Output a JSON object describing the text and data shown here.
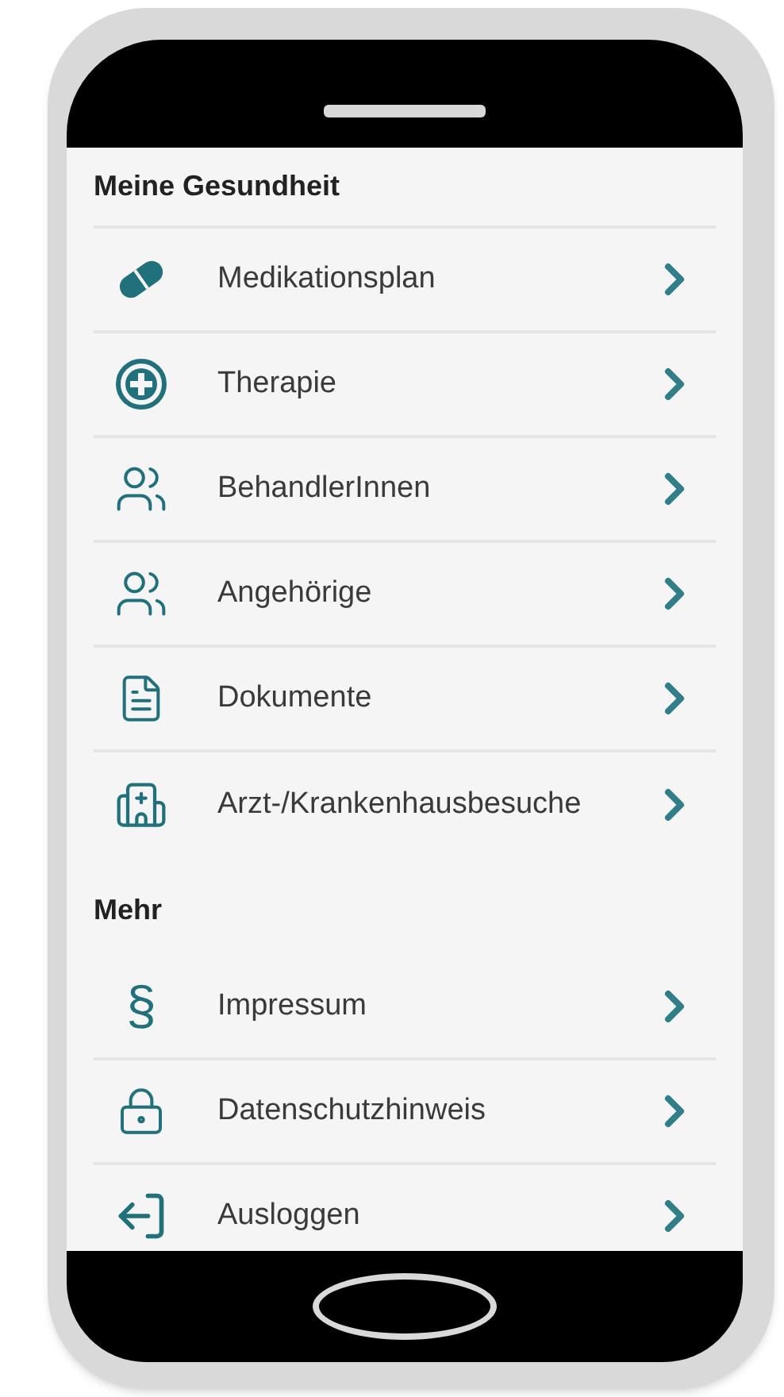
{
  "sections": [
    {
      "title": "Meine Gesundheit",
      "items": [
        {
          "label": "Medikationsplan"
        },
        {
          "label": "Therapie"
        },
        {
          "label": "BehandlerInnen"
        },
        {
          "label": "Angehörige"
        },
        {
          "label": "Dokumente"
        },
        {
          "label": "Arzt-/Krankenhausbesuche"
        }
      ]
    },
    {
      "title": "Mehr",
      "items": [
        {
          "label": "Impressum",
          "symbol": "§"
        },
        {
          "label": "Datenschutzhinweis"
        },
        {
          "label": "Ausloggen"
        }
      ]
    }
  ]
}
